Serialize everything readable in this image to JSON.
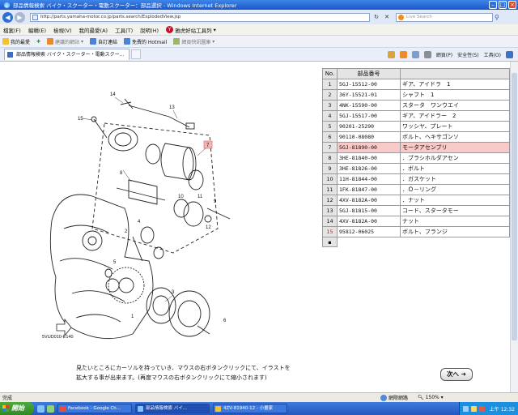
{
  "window": {
    "title": "部品情報検索 バイク・スクーター・電動スクーター：部品選択 - Windows Internet Explorer",
    "url": "http://parts.yamaha-motor.co.jp/parts.search/ExplodedView.jsp",
    "search_placeholder": "Live Search"
  },
  "menubar": {
    "items": [
      "檔案(F)",
      "編輯(E)",
      "檢視(V)",
      "我的最愛(A)",
      "工具(T)",
      "說明(H)"
    ],
    "yahoo": "雅虎好站工具列"
  },
  "favorites": {
    "label": "我的最愛",
    "items": [
      "建議的網站",
      "自訂連結",
      "免費的 Hotmail",
      "網頁快訊圖庫"
    ]
  },
  "tab": {
    "label": "部品情報検索 バイク・スクーター・電動スクー..."
  },
  "commands": [
    "網頁(P)",
    "安全性(S)",
    "工具(O)"
  ],
  "diagram": {
    "code": "5VUD010-E140",
    "callouts": [
      "14",
      "13",
      "15",
      "7",
      "6",
      "5",
      "4",
      "3",
      "2",
      "8",
      "9",
      "10",
      "11",
      "12",
      "1"
    ]
  },
  "parts_table": {
    "headers": [
      "No.",
      "部品番号",
      ""
    ],
    "rows": [
      {
        "no": "1",
        "part": "5GJ-15512-00",
        "name": "ギア、アイドラ　1",
        "selected": false,
        "red": false
      },
      {
        "no": "2",
        "part": "36Y-15521-01",
        "name": "シャフト　1",
        "selected": false,
        "red": false
      },
      {
        "no": "3",
        "part": "4NK-15590-00",
        "name": "スタータ　ワンウエイ",
        "selected": false,
        "red": false
      },
      {
        "no": "4",
        "part": "5GJ-15517-00",
        "name": "ギア、アイドラー　2",
        "selected": false,
        "red": false
      },
      {
        "no": "5",
        "part": "90201-25290",
        "name": "ワッシヤ、プレート",
        "selected": false,
        "red": false
      },
      {
        "no": "6",
        "part": "90110-08080",
        "name": "ボルト、ヘキサゴンソ",
        "selected": false,
        "red": false
      },
      {
        "no": "7",
        "part": "5GJ-81890-00",
        "name": "モータアセンブリ",
        "selected": true,
        "red": false
      },
      {
        "no": "8",
        "part": "3HE-81840-00",
        "name": "．ブラシホルダアセン",
        "selected": false,
        "red": false
      },
      {
        "no": "9",
        "part": "3HE-81826-00",
        "name": "．ボルト",
        "selected": false,
        "red": false
      },
      {
        "no": "10",
        "part": "11H-81844-00",
        "name": "．ガスケット",
        "selected": false,
        "red": false
      },
      {
        "no": "11",
        "part": "1FK-81847-00",
        "name": "．Ｏ－リング",
        "selected": false,
        "red": false
      },
      {
        "no": "12",
        "part": "4XV-8182A-00",
        "name": "．ナット",
        "selected": false,
        "red": false
      },
      {
        "no": "13",
        "part": "5GJ-81815-00",
        "name": "コード、スタータモー",
        "selected": false,
        "red": false
      },
      {
        "no": "14",
        "part": "4XV-8182A-00",
        "name": "ナット",
        "selected": false,
        "red": false
      },
      {
        "no": "15",
        "part": "95812-06025",
        "name": "ボルト、フランジ",
        "selected": false,
        "red": true
      }
    ],
    "end_marker": "▪"
  },
  "hint": {
    "line1": "見たいところにカーソルを持っていき、マウスの右ボタンクリックにて、イラストを",
    "line2": "拡大する事が出来ます。(再度マウスの右ボタンクリックにて縮小されます)"
  },
  "next_button": "次へ",
  "status": {
    "text": "完成",
    "zone": "網際網路",
    "zoom": "150%"
  },
  "taskbar": {
    "start": "開始",
    "tasks": [
      "Facebook - Google Ch...",
      "部品情報検索 バイ...",
      "4ZV-81940-12 - 小畫家"
    ],
    "clock": "上午 12:32"
  }
}
